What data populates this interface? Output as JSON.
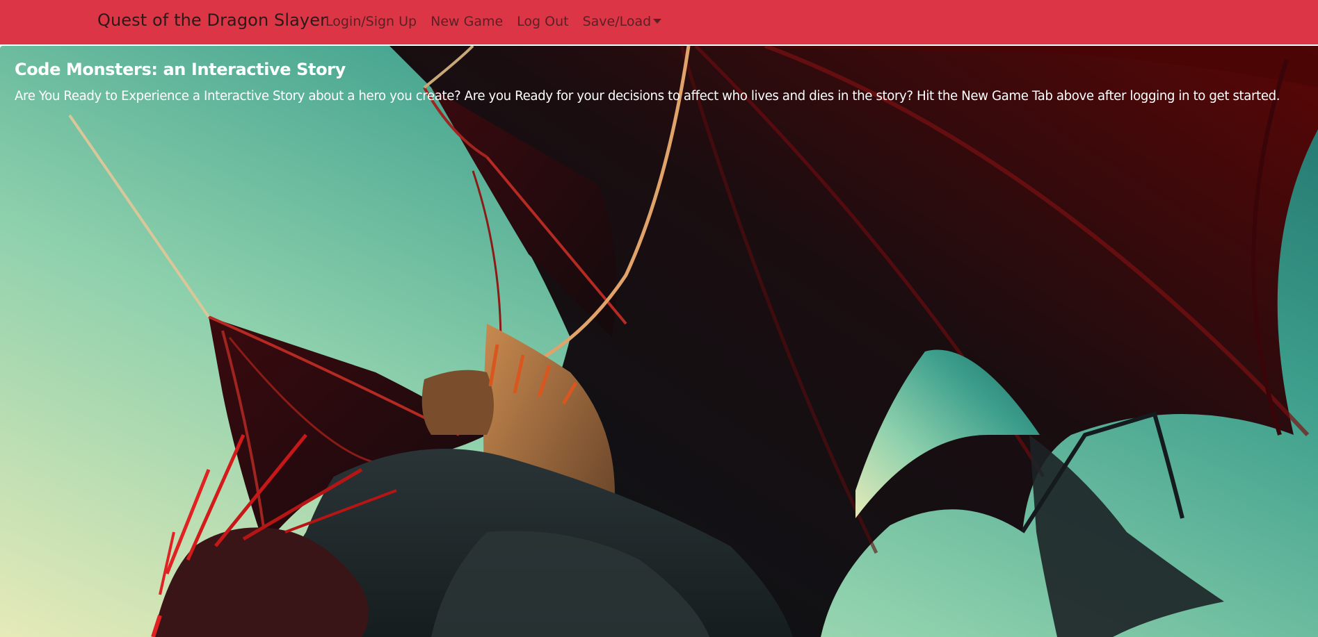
{
  "navbar": {
    "brand": "Quest of the Dragon Slayer",
    "links": [
      {
        "label": "Login/Sign Up"
      },
      {
        "label": "New Game"
      },
      {
        "label": "Log Out"
      },
      {
        "label": "Save/Load"
      }
    ],
    "background_color": "#dc3545"
  },
  "hero": {
    "title": "Code Monsters: an Interactive Story",
    "description": "Are You Ready to Experience a Interactive Story about a hero you create? Are you Ready for your decisions to affect who lives and dies in the story? Hit the New Game Tab above after logging in to get started."
  }
}
